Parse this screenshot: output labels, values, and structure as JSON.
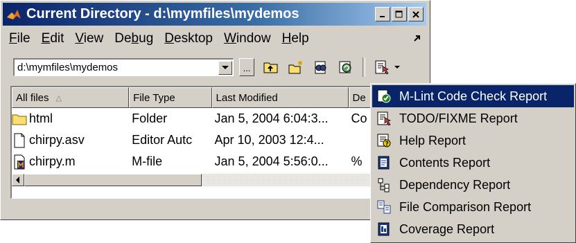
{
  "window": {
    "title": "Current Directory - d:\\mymfiles\\mydemos"
  },
  "menubar": {
    "items": [
      {
        "label": "File",
        "mnemonic": "F",
        "rest": "ile"
      },
      {
        "label": "Edit",
        "mnemonic": "E",
        "rest": "dit"
      },
      {
        "label": "View",
        "mnemonic": "V",
        "rest": "iew"
      },
      {
        "label": "Debug",
        "pre": "De",
        "mnemonic": "b",
        "rest": "ug"
      },
      {
        "label": "Desktop",
        "mnemonic": "D",
        "rest": "esktop"
      },
      {
        "label": "Window",
        "mnemonic": "W",
        "rest": "indow"
      },
      {
        "label": "Help",
        "mnemonic": "H",
        "rest": "elp"
      }
    ]
  },
  "toolbar": {
    "path_value": "d:\\mymfiles\\mydemos",
    "browse_label": "...",
    "icons": [
      "up-folder-icon",
      "new-folder-icon",
      "find-files-icon",
      "refresh-icon",
      "reports-icon"
    ]
  },
  "file_list": {
    "columns": [
      "All files",
      "File Type",
      "Last Modified",
      "De"
    ],
    "rows": [
      {
        "name": "html",
        "type": "Folder",
        "modified": "Jan 5, 2004 6:04:3...",
        "desc": "Co",
        "icon": "folder-icon"
      },
      {
        "name": "chirpy.asv",
        "type": "Editor Autc",
        "modified": "Apr 10, 2003 12:4...",
        "desc": "",
        "icon": "file-icon"
      },
      {
        "name": "chirpy.m",
        "type": "M-file",
        "modified": "Jan 5, 2004 5:56:0...",
        "desc": "%",
        "icon": "m-file-icon"
      }
    ]
  },
  "reports_menu": {
    "items": [
      {
        "label": "M-Lint Code Check Report",
        "icon": "mlint-check-icon",
        "selected": true
      },
      {
        "label": "TODO/FIXME Report",
        "icon": "todo-report-icon",
        "selected": false
      },
      {
        "label": "Help Report",
        "icon": "help-report-icon",
        "selected": false
      },
      {
        "label": "Contents Report",
        "icon": "contents-report-icon",
        "selected": false
      },
      {
        "label": "Dependency Report",
        "icon": "dependency-report-icon",
        "selected": false
      },
      {
        "label": "File Comparison Report",
        "icon": "file-comparison-icon",
        "selected": false
      },
      {
        "label": "Coverage Report",
        "icon": "coverage-report-icon",
        "selected": false
      }
    ]
  },
  "colors": {
    "title_active": "#0a246a",
    "selection": "#0a246a",
    "face": "#d4d0c8"
  }
}
